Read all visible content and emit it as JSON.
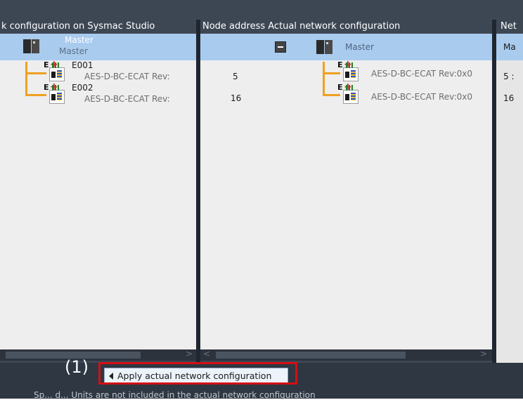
{
  "left_panel": {
    "header": "k configuration on Sysmac Studio",
    "master_name": "Master",
    "master_sub": "Master",
    "nodes": [
      {
        "id": "E001",
        "model": "AES-D-BC-ECAT Rev:"
      },
      {
        "id": "E002",
        "model": "AES-D-BC-ECAT Rev:"
      }
    ]
  },
  "mid_panel": {
    "header": "Node address Actual network configuration",
    "master_name": "Master",
    "nodes": [
      {
        "address": "5",
        "model": "AES-D-BC-ECAT Rev:0x0"
      },
      {
        "address": "16",
        "model": "AES-D-BC-ECAT Rev:0x0"
      }
    ]
  },
  "right_panel": {
    "header": "Net",
    "rows": [
      "Ma",
      "5 :",
      "16"
    ]
  },
  "callout": "(1)",
  "apply_button": "Apply actual network configuration",
  "footer_note": "Sp... d... Units are not included in the actual network configuration"
}
